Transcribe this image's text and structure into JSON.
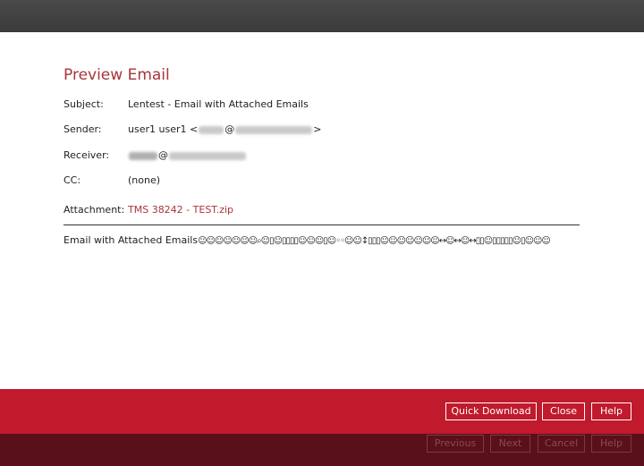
{
  "dialog": {
    "title": "Preview Email",
    "fields": {
      "subject_label": "Subject:",
      "subject_value": "Lentest - Email with Attached Emails",
      "sender_label": "Sender:",
      "sender_name": "user1 user1 <",
      "sender_at": "@",
      "sender_close": ">",
      "receiver_label": "Receiver:",
      "receiver_at": "@",
      "cc_label": "CC:",
      "cc_value": "(none)",
      "attachment_label": "Attachment:",
      "attachment_value": "TMS 38242  - TEST.zip"
    },
    "body_text": "Email with Attached Emails",
    "body_emoji": "☺☺☺☺☺☺☺⌕☺▯☺▯▯▯▯☺☺☺▯☺◦◦☺☺↕▯▯▯☺☺☺☺☺☺☺↔☺↔☺↔▯▯☺▯▯▯▯▯☺▯☺☺☺"
  },
  "actions": {
    "quick_download": "Quick Download",
    "close": "Close",
    "help": "Help"
  },
  "wizard": {
    "previous": "Previous",
    "next": "Next",
    "cancel": "Cancel",
    "help": "Help"
  }
}
